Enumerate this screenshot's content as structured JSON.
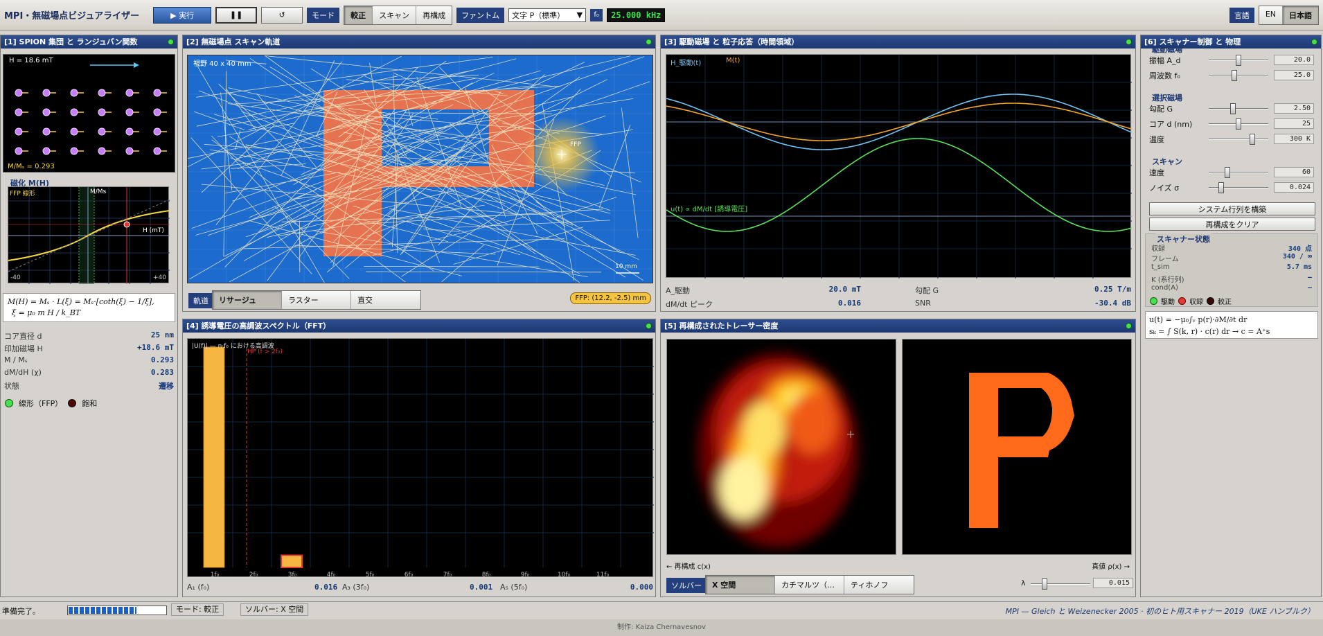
{
  "app": {
    "title": "MPI・無磁場点ビジュアライザー"
  },
  "toolbar": {
    "run": "▶ 実行",
    "pause": "❚❚",
    "reset": "↺",
    "mode_label": "モード",
    "modes": [
      "較正",
      "スキャン",
      "再構成"
    ],
    "phantom_label": "ファントム",
    "phantom_value": "文字 P（標準）",
    "f_label": "f₀",
    "freq": "25.000 kHz",
    "lang_label": "言語",
    "langs": [
      "EN",
      "日本語"
    ]
  },
  "p1": {
    "title": "[1] SPION 集団 と ランジュバン関数",
    "field": "H = 18.6 mT",
    "mms": "M/Mₛ = 0.293",
    "mh_title": "磁化 M(H)",
    "plot_label": "FFP 線形",
    "ms_label": "M/Ms",
    "h_label": "H (mT)",
    "xmin": "-40",
    "xmax": "+40",
    "formula1": "M(H) = Mₛ · L(ξ) = Mₛ·[coth(ξ) − 1/ξ],",
    "formula2": "ξ = μ₀ m H / k_BT",
    "rows": [
      {
        "k": "コア直径 d",
        "v": "25 nm"
      },
      {
        "k": "印加磁場 H",
        "v": "+18.6 mT"
      },
      {
        "k": "M / Mₛ",
        "v": "0.293"
      },
      {
        "k": "dM/dH (χ)",
        "v": "0.283"
      },
      {
        "k": "状態",
        "v": "遷移"
      }
    ],
    "legend": [
      "線形（FFP）",
      "飽和"
    ],
    "magnetization": 0.293
  },
  "p2": {
    "title": "[2] 無磁場点 スキャン軌道",
    "fov": "視野 40 x 40 mm",
    "ffp": "FFP",
    "scale": "10 mm",
    "traj_label": "軌道",
    "tabs": [
      "リサージュ",
      "ラスター",
      "直交"
    ],
    "ffp_pos": "FFP: (12.2, -2.5) mm"
  },
  "p3": {
    "title": "[3] 駆動磁場 と 粒子応答（時間領域）",
    "h_legend": "H_駆動(t)",
    "m_legend": "M(t)",
    "u_label": "u(t) ∝ dM/dt [誘導電圧]",
    "stats": [
      {
        "k": "A_駆動",
        "v": "20.0 mT"
      },
      {
        "k": "勾配 G",
        "v": "0.25 T/m"
      },
      {
        "k": "dM/dt ピーク",
        "v": "0.016"
      },
      {
        "k": "SNR",
        "v": "-30.4 dB"
      }
    ]
  },
  "p4": {
    "title": "[4] 誘導電圧の高調波スペクトル（FFT）",
    "legend": "|U(f)| — n·f₀ における高調波",
    "hp": "HP (f > 2f₀)",
    "chart_data": {
      "type": "bar",
      "categories": [
        "1f₀",
        "2f₀",
        "3f₀",
        "4f₀",
        "5f₀",
        "6f₀",
        "7f₀",
        "8f₀",
        "9f₀",
        "10f₀",
        "11f₀"
      ],
      "values": [
        1.0,
        0,
        0.055,
        0,
        0,
        0,
        0,
        0,
        0,
        0,
        0
      ]
    },
    "amps": [
      {
        "k": "A₁ (f₀)",
        "v": "0.016"
      },
      {
        "k": "A₃ (3f₀)",
        "v": "0.001"
      },
      {
        "k": "A₅ (5f₀)",
        "v": "0.000"
      }
    ]
  },
  "p5": {
    "title": "[5] 再構成されたトレーサー密度",
    "left_label": "← 再構成 c(x)",
    "right_label": "真値 ρ(x) →",
    "solver_label": "ソルバー",
    "solvers": [
      "X 空間",
      "カチマルツ（…",
      "ティホノフ"
    ],
    "lambda_label": "λ",
    "lambda": "0.015"
  },
  "p6": {
    "title": "[6] スキャナー制御 と 物理",
    "drive": {
      "title": "駆動磁場",
      "rows": [
        {
          "k": "振幅 A_d",
          "v": "20.0",
          "frac": 0.5
        },
        {
          "k": "周波数 f₀",
          "v": "25.0",
          "frac": 0.42
        }
      ]
    },
    "select": {
      "title": "選択磁場",
      "rows": [
        {
          "k": "勾配 G",
          "v": "2.50",
          "frac": 0.4
        },
        {
          "k": "コア d (nm)",
          "v": "25",
          "frac": 0.5
        },
        {
          "k": "温度",
          "v": "300 K",
          "frac": 0.75
        }
      ]
    },
    "scan": {
      "title": "スキャン",
      "rows": [
        {
          "k": "速度",
          "v": "60",
          "frac": 0.3
        },
        {
          "k": "ノイズ σ",
          "v": "0.024",
          "frac": 0.18
        }
      ]
    },
    "btn_build": "システム行列を構築",
    "btn_clear": "再構成をクリア",
    "state": {
      "title": "スキャナー状態",
      "rows": [
        {
          "k": "収録",
          "v": "340 点"
        },
        {
          "k": "フレーム",
          "v": "340 / ∞"
        },
        {
          "k": "t_sim",
          "v": "5.7 ms"
        },
        {
          "k": "K (系行列)",
          "v": "–"
        },
        {
          "k": "cond(A)",
          "v": "–"
        }
      ],
      "lights": [
        "駆動",
        "収録",
        "較正"
      ]
    },
    "eq1": "u(t) = −μ₀∫ᵥ p(r)·∂M/∂t dr",
    "eq2": "sₖ = ∫ S(k, r) · c(r) dr  →  c = A⁺s"
  },
  "status": {
    "ready": "準備完了。",
    "mode": "モード: 較正",
    "solver": "ソルバー: X 空間",
    "right": "MPI — Gleich と Weizenecker 2005 · 初のヒト用スキャナー 2019（UKE ハンブルク）",
    "progress": 0.7
  },
  "credit": "制作: Kaiza Chernavesnov",
  "colors": {
    "accent": "#1c3770",
    "led_green": "#49e04c",
    "bar": "#f5b642",
    "phantom": "#ff6a1a"
  }
}
